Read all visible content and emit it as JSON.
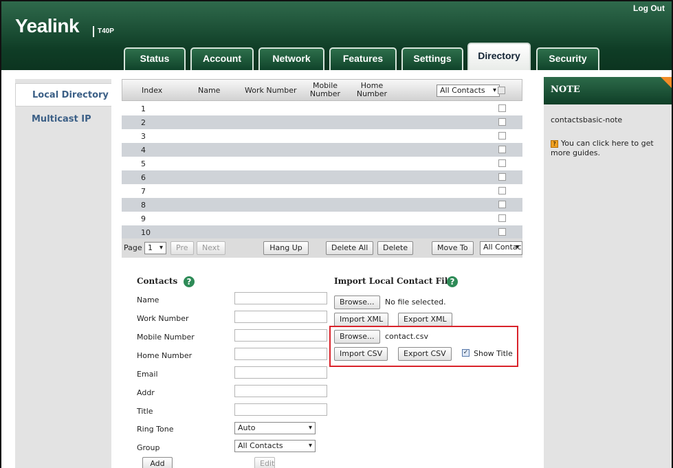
{
  "header": {
    "logo": "Yealink",
    "model": "T40P",
    "logout": "Log Out",
    "tabs": [
      "Status",
      "Account",
      "Network",
      "Features",
      "Settings",
      "Directory",
      "Security"
    ],
    "active_tab": "Directory"
  },
  "leftnav": {
    "items": [
      "Local Directory",
      "Multicast IP"
    ],
    "active": "Local Directory"
  },
  "table": {
    "headers": {
      "index": "Index",
      "name": "Name",
      "work": "Work Number",
      "mobile": "Mobile Number",
      "home": "Home Number"
    },
    "group_filter": "All Contacts",
    "rows": [
      "1",
      "2",
      "3",
      "4",
      "5",
      "6",
      "7",
      "8",
      "9",
      "10"
    ]
  },
  "pager": {
    "page_label": "Page",
    "page_value": "1",
    "pre": "Pre",
    "next": "Next",
    "hang_up": "Hang Up",
    "delete_all": "Delete All",
    "delete": "Delete",
    "move_to": "Move To",
    "move_target": "All Contac"
  },
  "contacts": {
    "title": "Contacts",
    "fields": [
      "Name",
      "Work Number",
      "Mobile Number",
      "Home Number",
      "Email",
      "Addr",
      "Title"
    ],
    "ring_tone_label": "Ring Tone",
    "ring_tone_value": "Auto",
    "group_label": "Group",
    "group_value": "All Contacts",
    "add": "Add",
    "edit": "Edit"
  },
  "import": {
    "title": "Import Local Contact File",
    "browse": "Browse...",
    "xml_file": "No file selected.",
    "import_xml": "Import XML",
    "export_xml": "Export XML",
    "csv_file": "contact.csv",
    "import_csv": "Import CSV",
    "export_csv": "Export CSV",
    "show_title": "Show Title"
  },
  "note": {
    "title": "NOTE",
    "line1": "contactsbasic-note",
    "line2": "You can click here to get more guides."
  },
  "colors": {
    "header_green": "#0f3d26",
    "accent_orange": "#f28c28",
    "highlight_red": "#d9222a"
  }
}
